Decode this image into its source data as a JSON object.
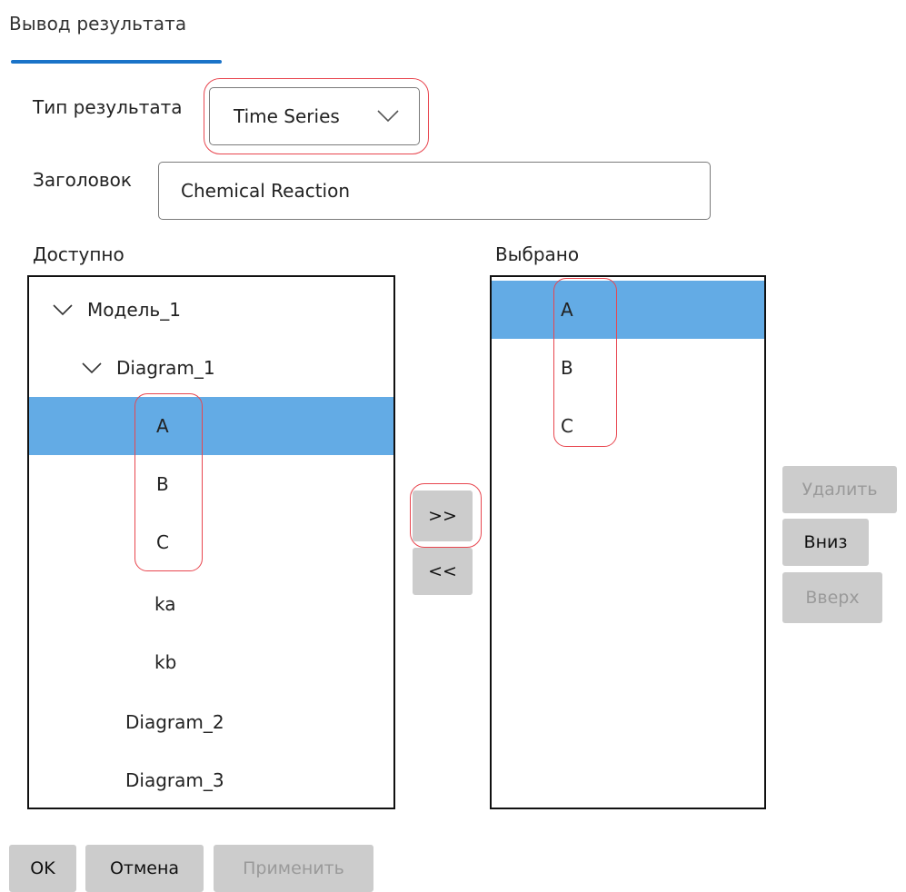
{
  "tab": {
    "title": "Вывод результата"
  },
  "form": {
    "result_type_label": "Тип результата",
    "result_type_value": "Time Series",
    "header_label": "Заголовок",
    "header_value": "Chemical Reaction"
  },
  "available": {
    "label": "Доступно",
    "items": [
      {
        "label": "Модель_1",
        "expanded": true,
        "selected": false
      },
      {
        "label": "Diagram_1",
        "expanded": true,
        "selected": false
      },
      {
        "label": "A",
        "selected": true
      },
      {
        "label": "B",
        "selected": false
      },
      {
        "label": "C",
        "selected": false
      },
      {
        "label": "ka",
        "selected": false
      },
      {
        "label": "kb",
        "selected": false
      },
      {
        "label": "Diagram_2",
        "selected": false
      },
      {
        "label": "Diagram_3",
        "selected": false
      }
    ]
  },
  "selected": {
    "label": "Выбрано",
    "items": [
      {
        "label": "A",
        "selected": true
      },
      {
        "label": "B",
        "selected": false
      },
      {
        "label": "C",
        "selected": false
      }
    ]
  },
  "transfer": {
    "add_label": ">>",
    "remove_label": "<<"
  },
  "side_buttons": {
    "delete_label": "Удалить",
    "down_label": "Вниз",
    "up_label": "Вверх"
  },
  "footer": {
    "ok_label": "OK",
    "cancel_label": "Отмена",
    "apply_label": "Применить"
  },
  "colors": {
    "accent": "#1a73c8",
    "selection": "#63abe5",
    "highlight": "#e8464f",
    "button": "#cccccc",
    "disabled_text": "#9a9a9a"
  },
  "icons": {
    "expand": "chevron-down-icon",
    "dropdown": "chevron-down-icon"
  }
}
